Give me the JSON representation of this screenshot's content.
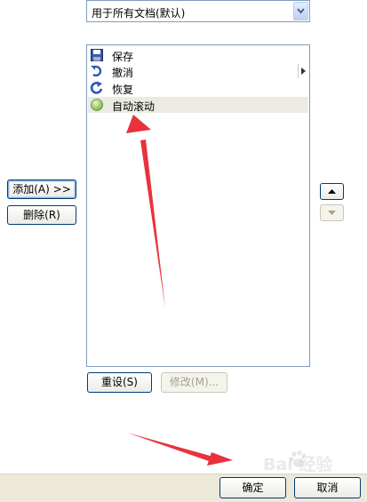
{
  "combo": {
    "value": "用于所有文档(默认)"
  },
  "list": {
    "items": [
      {
        "label": "保存",
        "icon": "save-icon"
      },
      {
        "label": "撤消",
        "icon": "undo-icon"
      },
      {
        "label": "恢复",
        "icon": "redo-icon"
      },
      {
        "label": "自动滚动",
        "icon": "auto-scroll-icon"
      }
    ],
    "selected_index": 3
  },
  "buttons": {
    "add": "添加(A) >>",
    "remove": "删除(R)",
    "reset": "重设(S)",
    "modify": "修改(M)...",
    "ok": "确定",
    "cancel": "取消"
  },
  "watermark": {
    "text": "Bai 经验"
  },
  "colors": {
    "annotation_arrow": "#e8333c",
    "selection": "#ecebe3",
    "button_border": "#003c74"
  }
}
